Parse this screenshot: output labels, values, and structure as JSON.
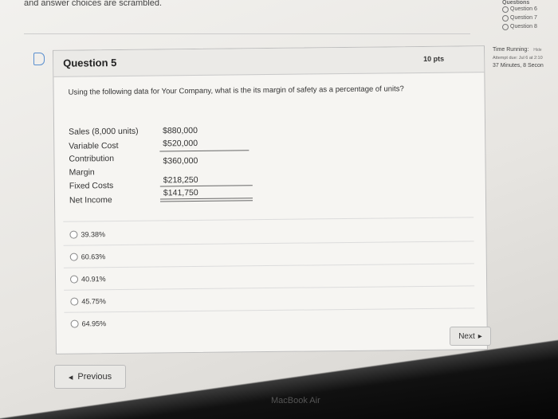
{
  "page": {
    "top_text": "and answer choices are scrambled."
  },
  "nav": {
    "heading": "Questions",
    "items": [
      {
        "label": "Question 6"
      },
      {
        "label": "Question 7"
      },
      {
        "label": "Question 8"
      }
    ]
  },
  "timer": {
    "label": "Time Running:",
    "hide_label": "Hide",
    "attempt": "Attempt due: Jul 6 at 2:10",
    "elapsed": "37 Minutes, 8 Secon"
  },
  "question": {
    "title": "Question 5",
    "points": "10 pts",
    "text": "Using the following data for Your Company, what is the its margin of safety as a percentage of units?",
    "table": {
      "sales_label": "Sales (8,000 units)",
      "sales_value": "$880,000",
      "varcost_label": "Variable Cost",
      "varcost_value": "$520,000",
      "contrib_label_1": "Contribution",
      "contrib_label_2": "Margin",
      "contrib_value": "$360,000",
      "fixed_label": "Fixed Costs",
      "fixed_value": "$218,250",
      "net_label": "Net Income",
      "net_value": "$141,750"
    },
    "options": [
      {
        "label": "39.38%"
      },
      {
        "label": "60.63%"
      },
      {
        "label": "40.91%"
      },
      {
        "label": "45.75%"
      },
      {
        "label": "64.95%"
      }
    ]
  },
  "buttons": {
    "next": "Next",
    "previous": "Previous"
  },
  "device": {
    "brand": "MacBook Air"
  }
}
